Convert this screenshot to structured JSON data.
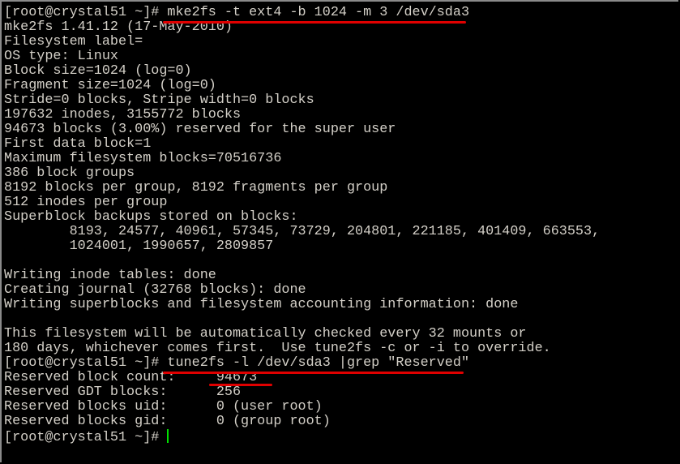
{
  "terminal": {
    "prompt": "[root@crystal51 ~]# ",
    "lines": [
      "[root@crystal51 ~]# mke2fs -t ext4 -b 1024 -m 3 /dev/sda3",
      "mke2fs 1.41.12 (17-May-2010)",
      "Filesystem label=",
      "OS type: Linux",
      "Block size=1024 (log=0)",
      "Fragment size=1024 (log=0)",
      "Stride=0 blocks, Stripe width=0 blocks",
      "197632 inodes, 3155772 blocks",
      "94673 blocks (3.00%) reserved for the super user",
      "First data block=1",
      "Maximum filesystem blocks=70516736",
      "386 block groups",
      "8192 blocks per group, 8192 fragments per group",
      "512 inodes per group",
      "Superblock backups stored on blocks:",
      "        8193, 24577, 40961, 57345, 73729, 204801, 221185, 401409, 663553,",
      "        1024001, 1990657, 2809857",
      "",
      "Writing inode tables: done",
      "Creating journal (32768 blocks): done",
      "Writing superblocks and filesystem accounting information: done",
      "",
      "This filesystem will be automatically checked every 32 mounts or",
      "180 days, whichever comes first.  Use tune2fs -c or -i to override.",
      "[root@crystal51 ~]# tune2fs -l /dev/sda3 |grep \"Reserved\"",
      "Reserved block count:     94673",
      "Reserved GDT blocks:      256",
      "Reserved blocks uid:      0 (user root)",
      "Reserved blocks gid:      0 (group root)"
    ]
  },
  "colors": {
    "background": "#000000",
    "text": "#d4d0c8",
    "annotation": "#e00000",
    "cursor": "#00e000"
  }
}
